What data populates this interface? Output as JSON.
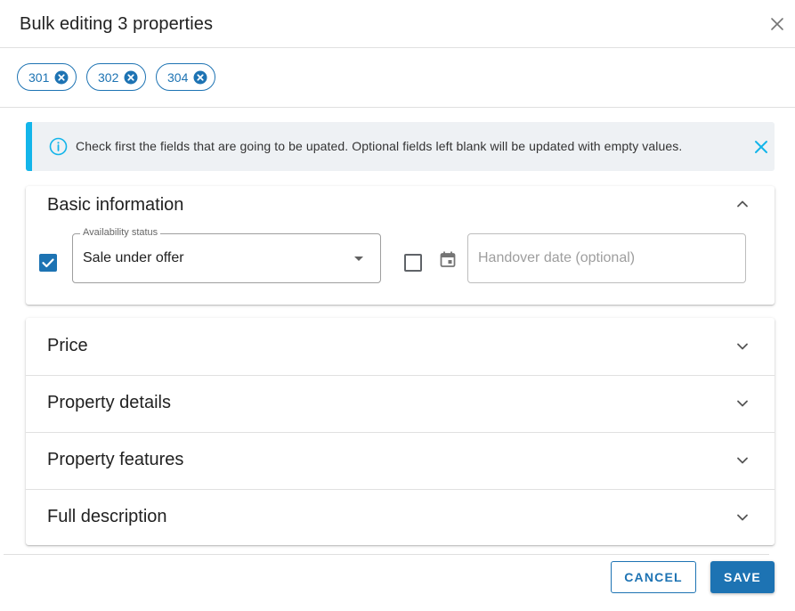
{
  "dialog": {
    "title": "Bulk editing 3 properties",
    "close_icon": "close-icon"
  },
  "chips": [
    {
      "label": "301",
      "icon": "cancel-circle-icon"
    },
    {
      "label": "302",
      "icon": "cancel-circle-icon"
    },
    {
      "label": "304",
      "icon": "cancel-circle-icon"
    }
  ],
  "alert": {
    "icon": "info-icon",
    "message": "Check first the fields that are going to be upated. Optional fields left blank will be updated with empty values.",
    "accent_color": "#13b5ea",
    "close_icon": "close-icon"
  },
  "basic_information": {
    "title": "Basic information",
    "expanded": true,
    "availability": {
      "checked": true,
      "label": "Availability status",
      "value": "Sale under offer"
    },
    "handover": {
      "checked": false,
      "icon": "calendar-icon",
      "placeholder": "Handover date (optional)"
    }
  },
  "sections": [
    {
      "title": "Price"
    },
    {
      "title": "Property details"
    },
    {
      "title": "Property features"
    },
    {
      "title": "Full description"
    }
  ],
  "footer": {
    "cancel_label": "CANCEL",
    "save_label": "SAVE"
  },
  "colors": {
    "primary": "#1d73b3",
    "alert_bg": "#eef1f4"
  }
}
